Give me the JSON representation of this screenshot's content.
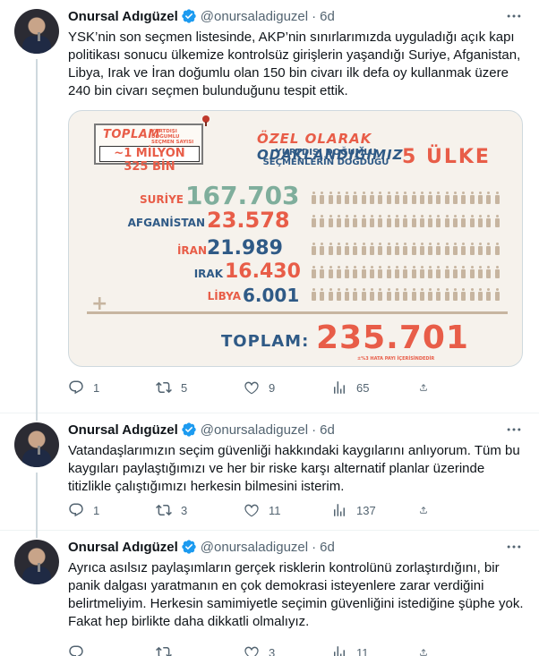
{
  "tweets": [
    {
      "name": "Onursal Adıgüzel",
      "handle": "@onursaladiguzel",
      "time": "6d",
      "text": "YSK’nin son seçmen listesinde, AKP’nin sınırlarımızda uyguladığı açık kapı politikası sonucu ülkemize kontrolsüz girişlerin yaşandığı Suriye, Afganistan, Libya, Irak ve İran doğumlu olan 150 bin civarı ilk defa oy kullanmak üzere 240 bin civarı seçmen bulunduğunu tespit ettik.",
      "replies": "1",
      "retweets": "5",
      "likes": "9",
      "views": "65"
    },
    {
      "name": "Onursal Adıgüzel",
      "handle": "@onursaladiguzel",
      "time": "6d",
      "text": "Vatandaşlarımızın seçim güvenliği hakkındaki kaygılarını anlıyorum. Tüm bu kaygıları paylaştığımızı ve her bir riske karşı alternatif planlar üzerinde titizlikle çalıştığımızı herkesin bilmesini isterim.",
      "replies": "1",
      "retweets": "3",
      "likes": "11",
      "views": "137"
    },
    {
      "name": "Onursal Adıgüzel",
      "handle": "@onursaladiguzel",
      "time": "6d",
      "text": "Ayrıca asılsız paylaşımların gerçek risklerin kontrolünü zorlaştırdığını, bir panik dalgası yaratmanın en çok demokrasi isteyenlere zarar verdiğini belirtmeliyim. Herkesin samimiyetle seçimin güvenliğini istediğine şüphe yok. Fakat hep birlikte daha dikkatli olmalıyız.",
      "replies": "",
      "retweets": "",
      "likes": "3",
      "views": "11"
    }
  ],
  "infographic": {
    "total_word": "TOPLAM",
    "total_sub": "YURTDIŞI DOĞUMLU SEÇMEN SAYISI",
    "total_value": "~1 MİLYON 325 BİN",
    "title_a": "ÖZEL OLARAK",
    "title_b": "ODAKLANDIĞIMIZ",
    "title_sub": "YURTDIŞI DOĞUMLU SEÇMENLERİN DOĞDUĞU",
    "title_count": "5 ÜLKE",
    "countries": [
      {
        "name": "SURİYE",
        "value": "167.703",
        "color": "#7fae9c"
      },
      {
        "name": "AFGANİSTAN",
        "value": "23.578",
        "color": "#e85d48"
      },
      {
        "name": "İRAN",
        "value": "21.989",
        "color": "#2f5a86"
      },
      {
        "name": "IRAK",
        "value": "16.430",
        "color": "#e85d48"
      },
      {
        "name": "LİBYA",
        "value": "6.001",
        "color": "#2f5a86"
      }
    ],
    "plus": "+",
    "sum_label": "TOPLAM:",
    "sum_value": "235.701",
    "note": "±%3 HATA PAYI İÇERİSİNDEDİR"
  },
  "colors": {
    "accent": "#e85d48",
    "navy": "#2f5a86",
    "teal": "#7fae9c",
    "muted": "#536471",
    "verified": "#1d9bf0"
  },
  "icons": [
    "more-icon",
    "verified-icon",
    "reply-icon",
    "retweet-icon",
    "like-icon",
    "views-icon",
    "share-icon"
  ]
}
